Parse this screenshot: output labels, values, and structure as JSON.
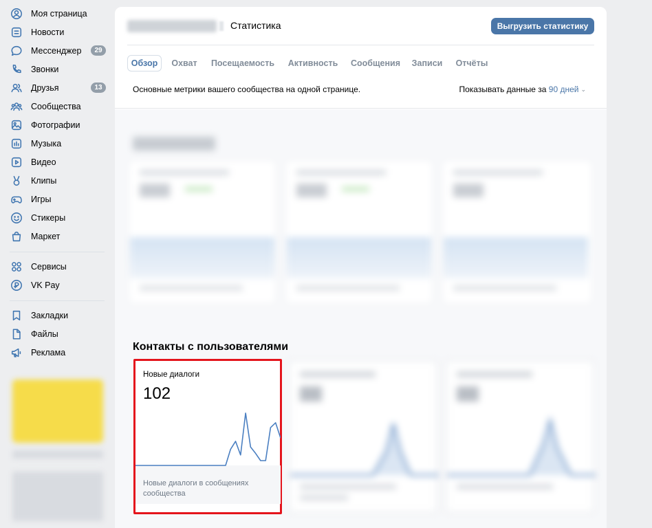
{
  "sidebar": {
    "items": [
      {
        "label": "Моя страница",
        "icon": "user-circle-icon",
        "badge": ""
      },
      {
        "label": "Новости",
        "icon": "news-icon",
        "badge": ""
      },
      {
        "label": "Мессенджер",
        "icon": "message-icon",
        "badge": "29"
      },
      {
        "label": "Звонки",
        "icon": "phone-icon",
        "badge": ""
      },
      {
        "label": "Друзья",
        "icon": "friends-icon",
        "badge": "13"
      },
      {
        "label": "Сообщества",
        "icon": "communities-icon",
        "badge": ""
      },
      {
        "label": "Фотографии",
        "icon": "photo-icon",
        "badge": ""
      },
      {
        "label": "Музыка",
        "icon": "music-icon",
        "badge": ""
      },
      {
        "label": "Видео",
        "icon": "video-icon",
        "badge": ""
      },
      {
        "label": "Клипы",
        "icon": "clips-icon",
        "badge": ""
      },
      {
        "label": "Игры",
        "icon": "games-icon",
        "badge": ""
      },
      {
        "label": "Стикеры",
        "icon": "stickers-icon",
        "badge": ""
      },
      {
        "label": "Маркет",
        "icon": "market-icon",
        "badge": ""
      }
    ],
    "services": [
      {
        "label": "Сервисы",
        "icon": "services-icon"
      },
      {
        "label": "VK Pay",
        "icon": "vkpay-icon"
      }
    ],
    "extra": [
      {
        "label": "Закладки",
        "icon": "bookmark-icon"
      },
      {
        "label": "Файлы",
        "icon": "file-icon"
      },
      {
        "label": "Реклама",
        "icon": "megaphone-icon"
      }
    ]
  },
  "header": {
    "title": "Статистика",
    "export_label": "Выгрузить статистику",
    "tabs": [
      "Обзор",
      "Охват",
      "Посещаемость",
      "Активность",
      "Сообщения",
      "Записи",
      "Отчёты"
    ],
    "active_tab": "Обзор",
    "description": "Основные метрики вашего сообщества на одной странице.",
    "period_prefix": "Показывать данные за",
    "period_value": "90 дней"
  },
  "contacts": {
    "section_title": "Контакты с пользователями",
    "card": {
      "title": "Новые диалоги",
      "value": "102",
      "footer": "Новые диалоги в сообщениях сообщества"
    }
  },
  "colors": {
    "accent": "#4a76a8",
    "icon": "#3f75b0",
    "highlight": "#e4141c",
    "chart_line": "#4a7fc1"
  },
  "chart_data": {
    "type": "line",
    "title": "Новые диалоги",
    "x": [
      0,
      1,
      2,
      3,
      4,
      5,
      6,
      7,
      8,
      9,
      10,
      11,
      12,
      13,
      14,
      15,
      16,
      17,
      18,
      19,
      20,
      21,
      22,
      23,
      24,
      25,
      26,
      27,
      28,
      29
    ],
    "series": [
      {
        "values": [
          0,
          0,
          0,
          0,
          0,
          0,
          0,
          0,
          0,
          0,
          0,
          0,
          0,
          0,
          0,
          0,
          0,
          0,
          0,
          2,
          3,
          1.3,
          6.5,
          2.3,
          1.5,
          0.6,
          0.6,
          4.7,
          5.3,
          3.4
        ]
      }
    ],
    "ylim": [
      0,
      7
    ],
    "grid": false,
    "legend": "none"
  }
}
